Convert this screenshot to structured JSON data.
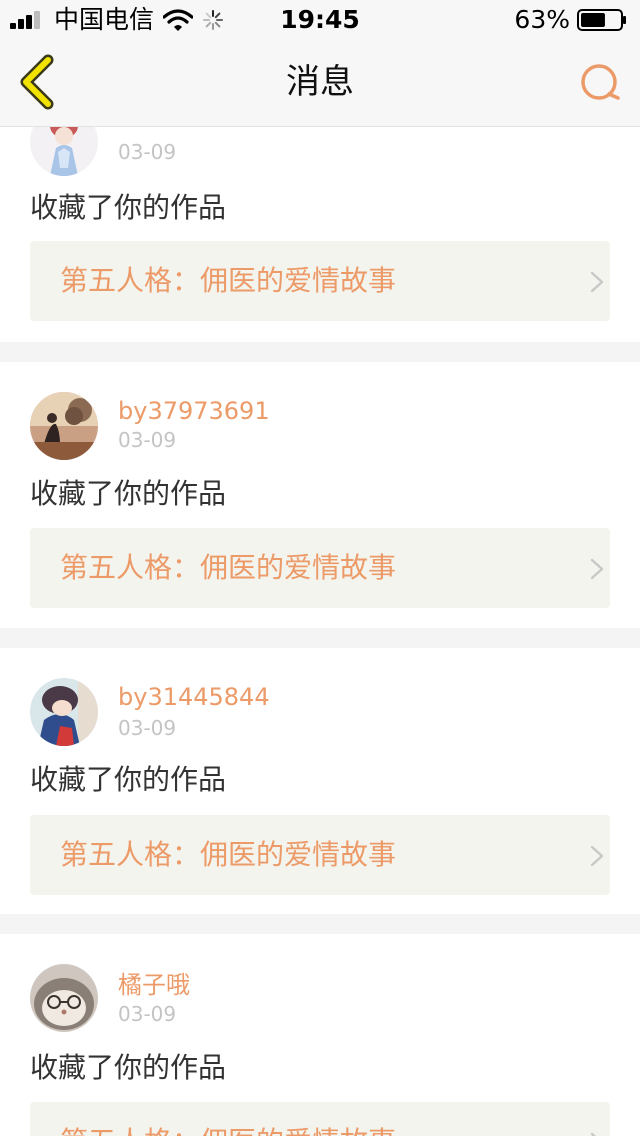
{
  "status_bar": {
    "carrier": "中国电信",
    "time": "19:45",
    "battery_percent": "63%",
    "battery_level": 0.63,
    "signal_bars": 3,
    "icons": [
      "signal-icon",
      "wifi-icon",
      "activity-spinner-icon",
      "battery-icon"
    ]
  },
  "nav": {
    "title": "消息",
    "back_icon": "chevron-left-icon",
    "search_icon": "search-icon"
  },
  "colors": {
    "accent": "#ec9a68",
    "back_arrow": "#f2e200",
    "text": "#333333",
    "date": "#c4c4c4",
    "work_box_bg": "#f4f4ee",
    "separator": "#f4f4f4"
  },
  "notifications": [
    {
      "username": "",
      "date": "03-09",
      "action": "收藏了你的作品",
      "work_title": "第五人格：佣医的爱情故事"
    },
    {
      "username": "by37973691",
      "date": "03-09",
      "action": "收藏了你的作品",
      "work_title": "第五人格：佣医的爱情故事"
    },
    {
      "username": "by31445844",
      "date": "03-09",
      "action": "收藏了你的作品",
      "work_title": "第五人格：佣医的爱情故事"
    },
    {
      "username": "橘子哦",
      "date": "03-09",
      "action": "收藏了你的作品",
      "work_title": "第五人格：佣医的爱情故事"
    }
  ]
}
